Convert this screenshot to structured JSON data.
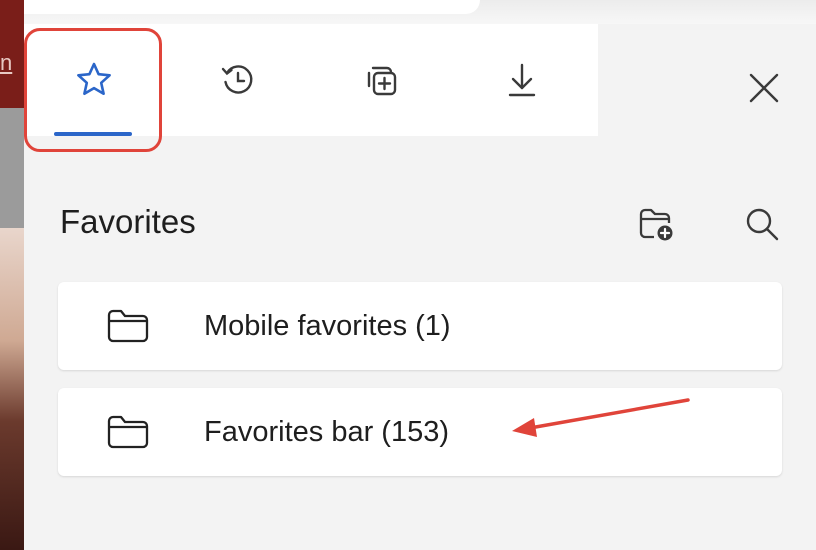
{
  "background": {
    "glyph": "n"
  },
  "panel": {
    "tabs": [
      {
        "name": "favorites",
        "icon": "star-icon",
        "active": true
      },
      {
        "name": "history",
        "icon": "history-icon",
        "active": false
      },
      {
        "name": "collections",
        "icon": "collections-icon",
        "active": false
      },
      {
        "name": "downloads",
        "icon": "download-icon",
        "active": false
      }
    ],
    "close_icon": "close-icon",
    "title": "Favorites",
    "header_icons": [
      "add-folder-icon",
      "search-icon"
    ],
    "items": [
      {
        "label": "Mobile favorites (1)",
        "icon": "folder-icon"
      },
      {
        "label": "Favorites bar (153)",
        "icon": "folder-icon"
      }
    ]
  },
  "colors": {
    "accent": "#2b66c9",
    "annotation": "#e0443a",
    "panel_bg": "#f3f3f3"
  },
  "annotations": {
    "highlight": "favorites-tab",
    "arrow_points_to": "Favorites bar (153)"
  }
}
